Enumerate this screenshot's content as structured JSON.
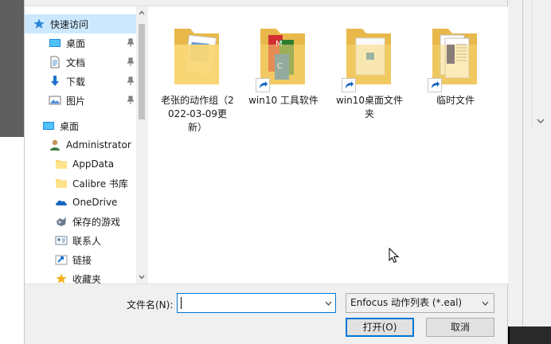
{
  "nav": {
    "items": [
      {
        "label": "快速访问",
        "icon": "star-icon",
        "selected": true
      },
      {
        "label": "桌面",
        "icon": "desktop-icon",
        "pinned": true
      },
      {
        "label": "文档",
        "icon": "document-icon",
        "pinned": true
      },
      {
        "label": "下载",
        "icon": "download-icon",
        "pinned": true
      },
      {
        "label": "图片",
        "icon": "pictures-icon",
        "pinned": true
      },
      {
        "label": "桌面",
        "icon": "desktop-icon"
      },
      {
        "label": "Administrator",
        "icon": "user-icon"
      },
      {
        "label": "AppData",
        "icon": "folder-icon"
      },
      {
        "label": "Calibre 书库",
        "icon": "folder-icon"
      },
      {
        "label": "OneDrive",
        "icon": "onedrive-icon"
      },
      {
        "label": "保存的游戏",
        "icon": "saved-games-icon"
      },
      {
        "label": "联系人",
        "icon": "contacts-icon"
      },
      {
        "label": "链接",
        "icon": "links-icon"
      },
      {
        "label": "收藏夹",
        "icon": "favorites-icon"
      }
    ]
  },
  "content": {
    "items": [
      {
        "label": "老张的动作组（2022-03-09更新）",
        "icon": "folder-icon",
        "shortcut": false
      },
      {
        "label": "win10 工具软件",
        "icon": "folder-shortcut-icon",
        "shortcut": true
      },
      {
        "label": "win10桌面文件夹",
        "icon": "folder-shortcut-icon",
        "shortcut": true
      },
      {
        "label": "临时文件",
        "icon": "folder-shortcut-icon",
        "shortcut": true
      }
    ]
  },
  "bottom": {
    "filename_label": "文件名(N):",
    "filename_value": "",
    "filetype_value": "Enfocus 动作列表 (*.eal)",
    "open_label": "打开(O)",
    "cancel_label": "取消"
  },
  "colors": {
    "selection": "#cce8ff",
    "accent": "#0078d7",
    "folder": "#f8d775"
  }
}
